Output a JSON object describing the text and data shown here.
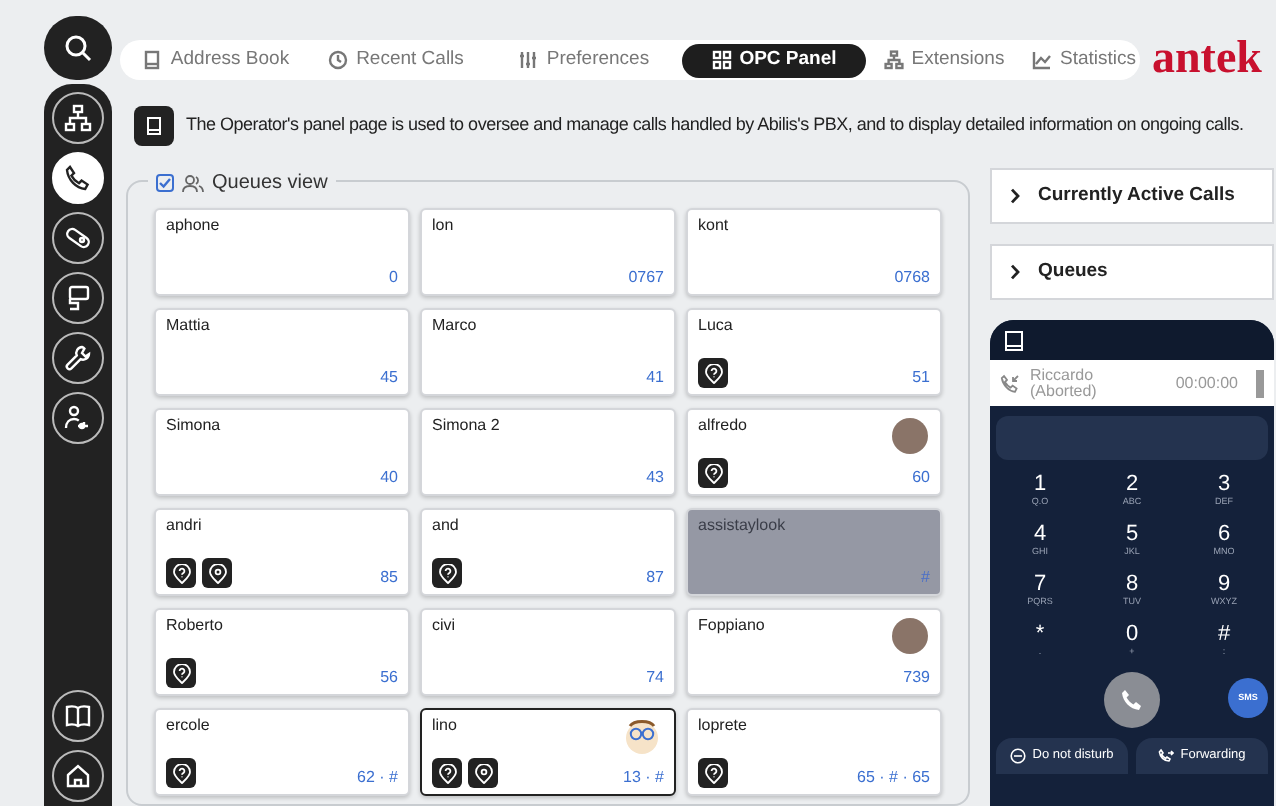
{
  "search": {
    "selected": false
  },
  "sidebar": {
    "items": [
      {
        "kind": "network",
        "selected": false
      },
      {
        "kind": "phone",
        "selected": true
      },
      {
        "kind": "pill",
        "selected": false
      },
      {
        "kind": "desk",
        "selected": false
      },
      {
        "kind": "wrench",
        "selected": false
      },
      {
        "kind": "user-key",
        "selected": false
      }
    ],
    "bottom_items": [
      {
        "kind": "book"
      },
      {
        "kind": "home"
      }
    ]
  },
  "tabs": [
    {
      "kind": "book",
      "label": "Address Book",
      "selected": false
    },
    {
      "kind": "clock",
      "label": "Recent Calls",
      "selected": false
    },
    {
      "kind": "sliders",
      "label": "Preferences",
      "selected": false
    },
    {
      "kind": "grid",
      "label": "OPC Panel",
      "selected": true
    },
    {
      "kind": "network",
      "label": "Extensions",
      "selected": false
    },
    {
      "kind": "chart",
      "label": "Statistics",
      "selected": false
    }
  ],
  "logo": "antek",
  "info": "The Operator's panel page is used to oversee and manage calls handled by Abilis's PBX, and to display detailed information on ongoing calls.",
  "queues_view": {
    "title": "Queues view",
    "checked": true,
    "cards": [
      {
        "name": "aphone",
        "number": "0",
        "selected": false,
        "unavailable": false
      },
      {
        "name": "lon",
        "number": "0767",
        "selected": false,
        "unavailable": false
      },
      {
        "name": "kont",
        "number": "0768",
        "selected": false,
        "unavailable": false
      },
      {
        "name": "Mattia",
        "number": "45",
        "selected": false,
        "unavailable": false
      },
      {
        "name": "Marco",
        "number": "41",
        "selected": false,
        "unavailable": false
      },
      {
        "name": "Luca",
        "number": "51",
        "badges": [
          {
            "kind": "question"
          }
        ],
        "selected": false,
        "unavailable": false
      },
      {
        "name": "Simona",
        "number": "40",
        "selected": false,
        "unavailable": false
      },
      {
        "name": "Simona 2",
        "number": "43",
        "selected": false,
        "unavailable": false
      },
      {
        "name": "alfredo",
        "number": "60",
        "badges": [
          {
            "kind": "question"
          }
        ],
        "avatar": {
          "kind": "photo"
        },
        "selected": false,
        "unavailable": false
      },
      {
        "name": "andri",
        "number": "85",
        "badges": [
          {
            "kind": "question"
          },
          {
            "kind": "location"
          }
        ],
        "selected": false,
        "unavailable": false
      },
      {
        "name": "and",
        "number": "87",
        "badges": [
          {
            "kind": "question"
          }
        ],
        "selected": false,
        "unavailable": false
      },
      {
        "name": "assistaylook",
        "number": "#",
        "selected": false,
        "unavailable": true
      },
      {
        "name": "Roberto",
        "number": "56",
        "badges": [
          {
            "kind": "question"
          }
        ],
        "selected": false,
        "unavailable": false
      },
      {
        "name": "civi",
        "number": "74",
        "selected": false,
        "unavailable": false
      },
      {
        "name": "Foppiano",
        "number": "739",
        "avatar": {
          "kind": "photo"
        },
        "selected": false,
        "unavailable": false
      },
      {
        "name": "ercole",
        "number": "62 · #",
        "badges": [
          {
            "kind": "question"
          }
        ],
        "selected": false,
        "unavailable": false
      },
      {
        "name": "lino",
        "number": "13 · #",
        "badges": [
          {
            "kind": "question"
          },
          {
            "kind": "location"
          }
        ],
        "avatar": {
          "kind": "cartoon"
        },
        "selected": true,
        "unavailable": false
      },
      {
        "name": "loprete",
        "number": "65 · # · 65",
        "badges": [
          {
            "kind": "question"
          }
        ],
        "selected": false,
        "unavailable": false
      }
    ]
  },
  "panels": [
    {
      "title": "Currently Active Calls",
      "expanded": false
    },
    {
      "title": "Queues",
      "expanded": false
    }
  ],
  "phone": {
    "call": {
      "name": "Riccardo",
      "status": "(Aborted)",
      "time": "00:00:00"
    },
    "keys": [
      {
        "digit": "1",
        "letters": "Q.O"
      },
      {
        "digit": "2",
        "letters": "ABC"
      },
      {
        "digit": "3",
        "letters": "DEF"
      },
      {
        "digit": "4",
        "letters": "GHI"
      },
      {
        "digit": "5",
        "letters": "JKL"
      },
      {
        "digit": "6",
        "letters": "MNO"
      },
      {
        "digit": "7",
        "letters": "PQRS"
      },
      {
        "digit": "8",
        "letters": "TUV"
      },
      {
        "digit": "9",
        "letters": "WXYZ"
      },
      {
        "digit": "*",
        "letters": "."
      },
      {
        "digit": "0",
        "letters": "+"
      },
      {
        "digit": "#",
        "letters": ":"
      }
    ],
    "sms": "SMS",
    "buttons": [
      {
        "kind": "dnd",
        "label": "Do not disturb"
      },
      {
        "kind": "forward",
        "label": "Forwarding"
      }
    ]
  }
}
